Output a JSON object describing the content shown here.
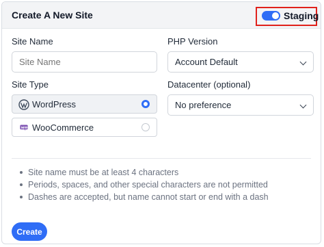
{
  "header": {
    "title": "Create A New Site",
    "staging_label": "Staging",
    "staging_enabled": true
  },
  "site_name": {
    "label": "Site Name",
    "placeholder": "Site Name",
    "value": ""
  },
  "php_version": {
    "label": "PHP Version",
    "selected": "Account Default"
  },
  "site_type": {
    "label": "Site Type",
    "options": [
      {
        "label": "WordPress",
        "selected": true,
        "icon": "wordpress-icon"
      },
      {
        "label": "WooCommerce",
        "selected": false,
        "icon": "woocommerce-icon"
      }
    ]
  },
  "datacenter": {
    "label": "Datacenter (optional)",
    "selected": "No preference"
  },
  "rules": [
    "Site name must be at least 4 characters",
    "Periods, spaces, and other special characters are not permitted",
    "Dashes are accepted, but name cannot start or end with a dash"
  ],
  "create_button": "Create",
  "colors": {
    "accent": "#2f6df6",
    "highlight_box": "#e0211b"
  }
}
